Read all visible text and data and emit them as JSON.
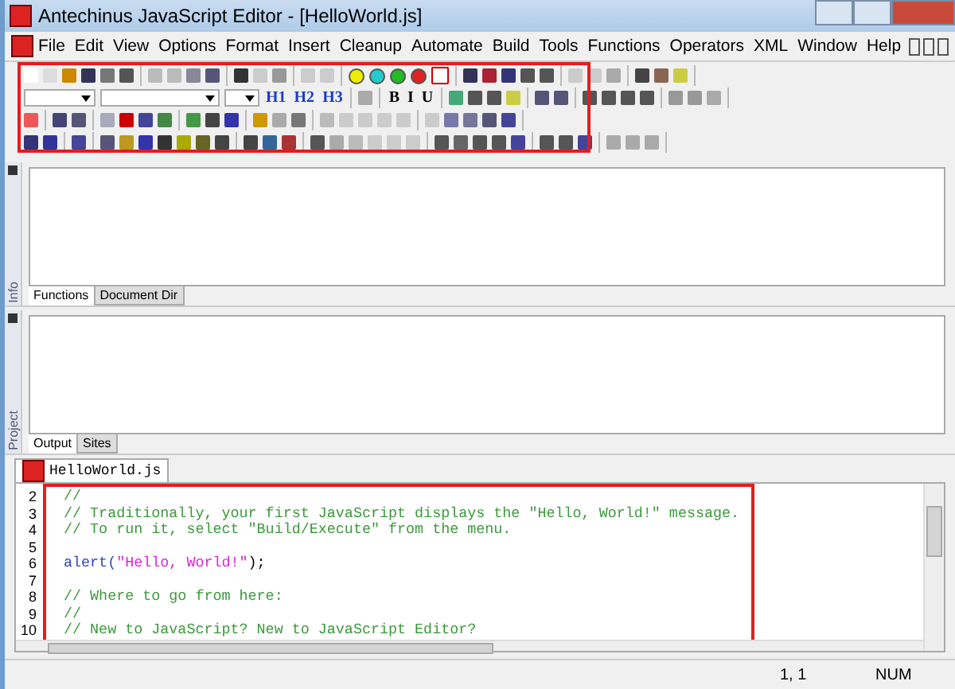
{
  "window": {
    "title": "Antechinus JavaScript Editor - [HelloWorld.js]"
  },
  "menu": [
    {
      "label": "File"
    },
    {
      "label": "Edit"
    },
    {
      "label": "View"
    },
    {
      "label": "Options"
    },
    {
      "label": "Format"
    },
    {
      "label": "Insert"
    },
    {
      "label": "Cleanup"
    },
    {
      "label": "Automate"
    },
    {
      "label": "Build"
    },
    {
      "label": "Tools"
    },
    {
      "label": "Functions"
    },
    {
      "label": "Operators"
    },
    {
      "label": "XML"
    },
    {
      "label": "Window"
    },
    {
      "label": "Help"
    }
  ],
  "format_buttons": [
    {
      "label": "H1"
    },
    {
      "label": "H2"
    },
    {
      "label": "H3"
    },
    {
      "label": "B"
    },
    {
      "label": "I"
    },
    {
      "label": "U"
    }
  ],
  "info_panel": {
    "side_label": "Info",
    "tabs": [
      {
        "label": "Functions",
        "selected": true
      },
      {
        "label": "Document Dir",
        "selected": false
      }
    ]
  },
  "project_panel": {
    "side_label": "Project",
    "tabs": [
      {
        "label": "Output",
        "selected": true
      },
      {
        "label": "Sites",
        "selected": false
      }
    ]
  },
  "editor": {
    "tab": "HelloWorld.js",
    "lines": [
      {
        "number": "2",
        "tokens": [
          {
            "text": "//",
            "kind": "comment"
          }
        ]
      },
      {
        "number": "3",
        "tokens": [
          {
            "text": "// Traditionally, your first JavaScript displays the \"Hello, World!\" message.",
            "kind": "comment"
          }
        ]
      },
      {
        "number": "4",
        "tokens": [
          {
            "text": "// To run it, select \"Build/Execute\" from the menu.",
            "kind": "comment"
          }
        ]
      },
      {
        "number": "5"
      },
      {
        "number": "6",
        "tokens": [
          {
            "text": "alert(",
            "kind": "keyword"
          },
          {
            "text": "\"Hello, World!\"",
            "kind": "string"
          },
          {
            "text": ");",
            "kind": "plain"
          }
        ]
      },
      {
        "number": "7"
      },
      {
        "number": "8",
        "tokens": [
          {
            "text": "// Where to go from here:",
            "kind": "comment"
          }
        ]
      },
      {
        "number": "9",
        "tokens": [
          {
            "text": "//",
            "kind": "comment"
          }
        ]
      },
      {
        "number": "10",
        "tokens": [
          {
            "text": "// New to JavaScript? New to JavaScript Editor?",
            "kind": "comment"
          }
        ]
      }
    ]
  },
  "status_bar": {
    "position": "1, 1",
    "num": "NUM"
  }
}
